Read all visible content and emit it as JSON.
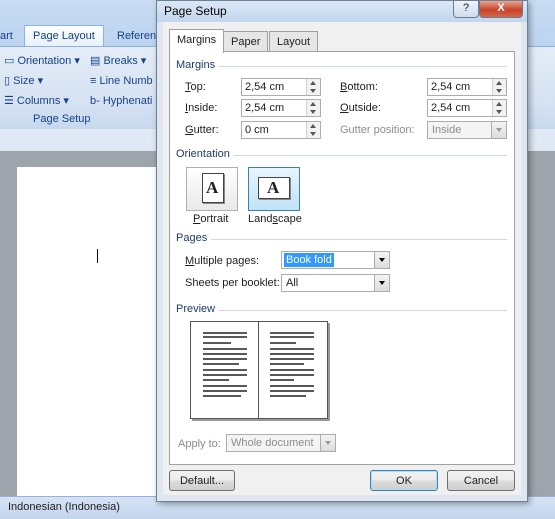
{
  "word": {
    "title_tabs": [
      "art",
      "Page Layout",
      "Referen"
    ],
    "ribbon": {
      "orientation": "Orientation",
      "size": "Size",
      "columns": "Columns",
      "breaks": "Breaks",
      "line_numbers": "Line Numb",
      "hyphenation": "Hyphenati",
      "group_label": "Page Setup"
    },
    "status_language": "Indonesian (Indonesia)"
  },
  "dialog": {
    "title": "Page Setup",
    "help_label": "?",
    "close_label": "X",
    "tabs": [
      "Margins",
      "Paper",
      "Layout"
    ],
    "margins_section": "Margins",
    "fields": {
      "top": {
        "label_u": "T",
        "label_rest": "op:",
        "value": "2,54 cm"
      },
      "bottom": {
        "label_u": "B",
        "label_rest": "ottom:",
        "value": "2,54 cm"
      },
      "inside": {
        "label_u": "I",
        "label_rest": "nside:",
        "value": "2,54 cm"
      },
      "outside": {
        "label_u": "O",
        "label_rest": "utside:",
        "value": "2,54 cm"
      },
      "gutter": {
        "label_u": "G",
        "label_rest": "utter:",
        "value": "0 cm"
      },
      "gutter_position": {
        "label": "Gutter position:",
        "value": "Inside"
      }
    },
    "orientation_section": "Orientation",
    "portrait": {
      "label_u": "P",
      "label_rest": "ortrait",
      "glyph": "A"
    },
    "landscape": {
      "label_pre": "Land",
      "label_u": "s",
      "label_rest": "cape",
      "glyph": "A"
    },
    "pages_section": "Pages",
    "multiple_pages": {
      "label_u": "M",
      "label_rest": "ultiple pages:",
      "value": "Book fold"
    },
    "sheets_per_booklet": {
      "label": "Sheets per booklet:",
      "value": "All"
    },
    "preview_section": "Preview",
    "apply_to": {
      "label": "Apply to:",
      "value": "Whole document"
    },
    "buttons": {
      "default": "Default...",
      "ok": "OK",
      "cancel": "Cancel"
    }
  }
}
